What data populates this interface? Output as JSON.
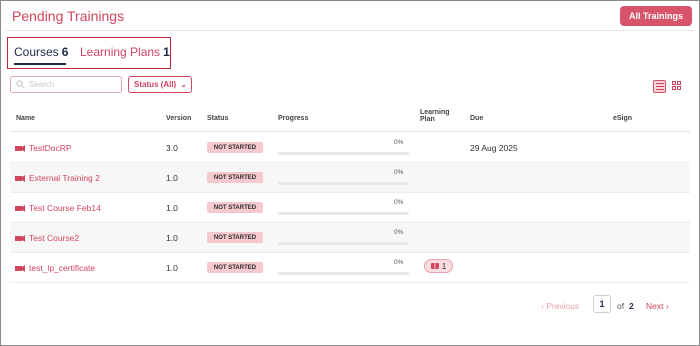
{
  "page": {
    "title": "Pending Trainings",
    "all_trainings_label": "All Trainings"
  },
  "tabs": [
    {
      "label": "Courses",
      "count": "6",
      "active": true
    },
    {
      "label": "Learning Plans",
      "count": "1",
      "active": false
    }
  ],
  "filters": {
    "search_placeholder": "Search",
    "status_label": "Status (All)"
  },
  "table": {
    "headers": {
      "name": "Name",
      "version": "Version",
      "status": "Status",
      "progress": "Progress",
      "learning_plan_1": "Learning",
      "learning_plan_2": "Plan",
      "due": "Due",
      "esign": "eSign"
    },
    "rows": [
      {
        "name": "TestDocRP",
        "version": "3.0",
        "status": "NOT STARTED",
        "progress_label": "0%",
        "progress": 0,
        "learning_plan": "",
        "due": "29 Aug 2025"
      },
      {
        "name": "External Training 2",
        "version": "1.0",
        "status": "NOT STARTED",
        "progress_label": "0%",
        "progress": 0,
        "learning_plan": "",
        "due": ""
      },
      {
        "name": "Test Course Feb14",
        "version": "1.0",
        "status": "NOT STARTED",
        "progress_label": "0%",
        "progress": 0,
        "learning_plan": "",
        "due": ""
      },
      {
        "name": "Test Course2",
        "version": "1.0",
        "status": "NOT STARTED",
        "progress_label": "0%",
        "progress": 0,
        "learning_plan": "",
        "due": ""
      },
      {
        "name": "test_lp_certificate",
        "version": "1.0",
        "status": "NOT STARTED",
        "progress_label": "0%",
        "progress": 0,
        "learning_plan": "1",
        "due": ""
      }
    ]
  },
  "pagination": {
    "previous": "‹ Previous",
    "current": "1",
    "of": "of",
    "total": "2",
    "next": "Next ›"
  },
  "colors": {
    "accent": "#d2455f",
    "badge_bg": "#f6c9cf",
    "navy": "#1e2a44"
  }
}
